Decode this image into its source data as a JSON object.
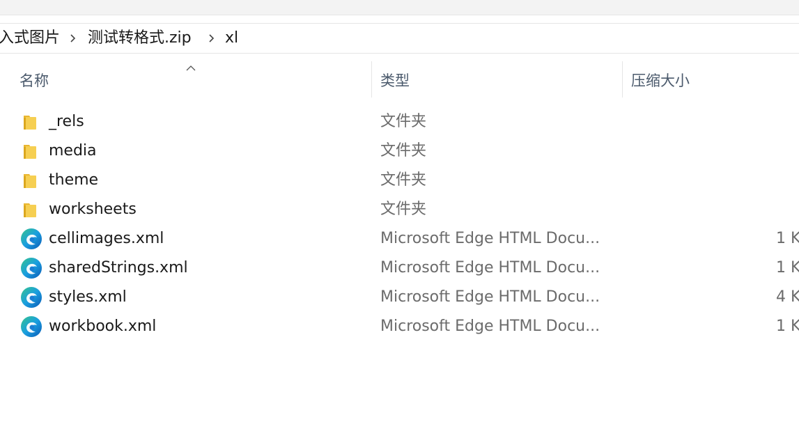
{
  "breadcrumb": {
    "items": [
      {
        "label": "入式图片"
      },
      {
        "label": "测试转格式.zip"
      },
      {
        "label": "xl"
      }
    ]
  },
  "columns": {
    "name": "名称",
    "type": "类型",
    "compressed_size": "压缩大小"
  },
  "colors": {
    "folder": "#f4c542",
    "edge_blue": "#0c7bd6",
    "edge_green": "#36c48b",
    "header_text": "#4b5a6c"
  },
  "files": [
    {
      "name": "_rels",
      "type": "文件夹",
      "size": "",
      "icon": "folder-icon"
    },
    {
      "name": "media",
      "type": "文件夹",
      "size": "",
      "icon": "folder-icon"
    },
    {
      "name": "theme",
      "type": "文件夹",
      "size": "",
      "icon": "folder-icon"
    },
    {
      "name": "worksheets",
      "type": "文件夹",
      "size": "",
      "icon": "folder-icon"
    },
    {
      "name": "cellimages.xml",
      "type": "Microsoft Edge HTML Docu...",
      "size": "1 K",
      "icon": "edge-icon"
    },
    {
      "name": "sharedStrings.xml",
      "type": "Microsoft Edge HTML Docu...",
      "size": "1 K",
      "icon": "edge-icon"
    },
    {
      "name": "styles.xml",
      "type": "Microsoft Edge HTML Docu...",
      "size": "4 K",
      "icon": "edge-icon"
    },
    {
      "name": "workbook.xml",
      "type": "Microsoft Edge HTML Docu...",
      "size": "1 K",
      "icon": "edge-icon"
    }
  ]
}
